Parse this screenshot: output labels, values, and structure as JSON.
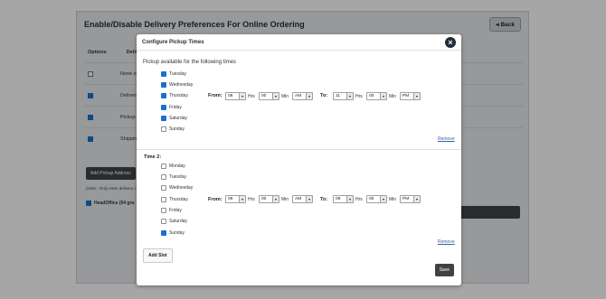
{
  "page": {
    "title": "Enable/Disable Delivery Preferences For Online Ordering",
    "back_label": "Back",
    "table_headers": [
      "Options",
      "Deliver"
    ],
    "rows": [
      {
        "checked": false,
        "label": "None of"
      },
      {
        "checked": true,
        "label": "Delivery"
      },
      {
        "checked": true,
        "label": "Pickup"
      },
      {
        "checked": true,
        "label": "Shippin"
      }
    ],
    "add_pickup_label": "Add Pickup Address",
    "note": "(Note : Only enter delivery c",
    "headoffice": "HeadOffice (54 gra"
  },
  "modal": {
    "title": "Configure Pickup Times",
    "intro": "Pickup available for the following times",
    "slot1": {
      "days": [
        {
          "name": "Tuesday",
          "checked": true
        },
        {
          "name": "Wednesday",
          "checked": true
        },
        {
          "name": "Thursday",
          "checked": true
        },
        {
          "name": "Friday",
          "checked": true
        },
        {
          "name": "Saturday",
          "checked": true
        },
        {
          "name": "Sunday",
          "checked": false
        }
      ],
      "from_label": "From:",
      "to_label": "To:",
      "from_hrs": "08",
      "from_min": "00",
      "from_ampm": "AM",
      "to_hrs": "11",
      "to_min": "00",
      "to_ampm": "PM",
      "hrs_label": "Hrs",
      "min_label": "Min",
      "remove_label": "Remove"
    },
    "slot2": {
      "title": "Time 2:",
      "days": [
        {
          "name": "Monday",
          "checked": false
        },
        {
          "name": "Tuesday",
          "checked": false
        },
        {
          "name": "Wednesday",
          "checked": false
        },
        {
          "name": "Thursday",
          "checked": false
        },
        {
          "name": "Friday",
          "checked": false
        },
        {
          "name": "Saturday",
          "checked": false
        },
        {
          "name": "Sunday",
          "checked": true
        }
      ],
      "from_label": "From:",
      "to_label": "To:",
      "from_hrs": "08",
      "from_min": "00",
      "from_ampm": "AM",
      "to_hrs": "09",
      "to_min": "00",
      "to_ampm": "PM",
      "hrs_label": "Hrs",
      "min_label": "Min",
      "remove_label": "Remove"
    },
    "add_slot_label": "Add Slot",
    "save_label": "Save"
  },
  "icons": {
    "close": "close-icon",
    "back": "chevron-left-icon",
    "dropdown": "caret-down-icon"
  },
  "colors": {
    "checkbox_checked": "#1b6fd1",
    "dark_button": "#3f4245",
    "link": "#3a5fb0",
    "close_button": "#1e2c3a"
  }
}
